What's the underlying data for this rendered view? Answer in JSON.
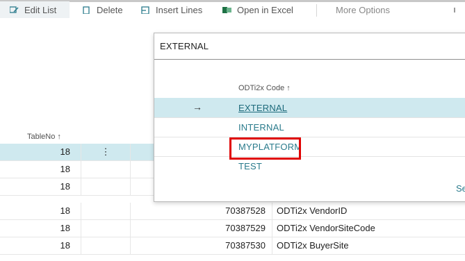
{
  "toolbar": {
    "items": [
      {
        "label": "Edit List",
        "icon": "edit-list-icon"
      },
      {
        "label": "Delete",
        "icon": "delete-icon"
      },
      {
        "label": "Insert Lines",
        "icon": "insert-lines-icon"
      },
      {
        "label": "Open in Excel",
        "icon": "excel-icon"
      },
      {
        "label": "More Options"
      }
    ]
  },
  "grid": {
    "column_header": "TableNo ↑",
    "rows": [
      {
        "table_no": "18",
        "menu": "⋮",
        "field_no": "",
        "field_name": ""
      },
      {
        "table_no": "18",
        "menu": "",
        "field_no": "",
        "field_name": ""
      },
      {
        "table_no": "18",
        "menu": "",
        "field_no": "",
        "field_name": ""
      },
      {
        "table_no": "18",
        "menu": "",
        "field_no": "70387528",
        "field_name": "ODTi2x VendorID"
      },
      {
        "table_no": "18",
        "menu": "",
        "field_no": "70387529",
        "field_name": "ODTi2x VendorSiteCode"
      },
      {
        "table_no": "18",
        "menu": "",
        "field_no": "70387530",
        "field_name": "ODTi2x BuyerSite"
      }
    ]
  },
  "lookup": {
    "input_value": "EXTERNAL",
    "column_header": "ODTi2x Code ↑",
    "selected_arrow": "→",
    "options": [
      "EXTERNAL",
      "INTERNAL",
      "MYPLATFORM",
      "TEST"
    ],
    "selected_index": 0,
    "highlighted_option": "MYPLATFORM",
    "footer_link": "Sele"
  },
  "colors": {
    "selection": "#cfe9ef",
    "link": "#2a7b8c",
    "highlight_box": "#e00000"
  }
}
